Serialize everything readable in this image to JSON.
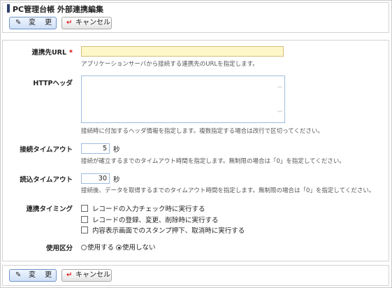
{
  "page": {
    "title": "PC管理台帳 外部連携編集"
  },
  "toolbar": {
    "change_label": "変 更",
    "change_icon": "pencil-icon",
    "cancel_label": "キャンセル",
    "cancel_icon": "return-arrow-icon"
  },
  "form": {
    "url": {
      "label": "連携先URL",
      "required_mark": "*",
      "value": "",
      "help": "アプリケーションサーバから接続する連携先のURLを指定します。"
    },
    "http_header": {
      "label": "HTTPヘッダ",
      "value": "",
      "help": "接続時に付加するヘッダ情報を指定します。複数指定する場合は改行で区切ってください。"
    },
    "connect_timeout": {
      "label": "接続タイムアウト",
      "value": "5",
      "unit": "秒",
      "help": "接続が確立するまでのタイムアウト時間を指定します。無制限の場合は「0」を指定してください。"
    },
    "read_timeout": {
      "label": "読込タイムアウト",
      "value": "30",
      "unit": "秒",
      "help": "接続後、データを取得するまでのタイムアウト時間を指定します。無制限の場合は「0」を指定してください。"
    },
    "timing": {
      "label": "連携タイミング",
      "options": [
        {
          "label": "レコードの入力チェック時に実行する",
          "checked": false
        },
        {
          "label": "レコードの登録、変更、削除時に実行する",
          "checked": false
        },
        {
          "label": "内容表示画面でのスタンプ押下、取消時に実行する",
          "checked": false
        }
      ]
    },
    "usage": {
      "label": "使用区分",
      "options": [
        {
          "label": "使用する",
          "selected": false
        },
        {
          "label": "使用しない",
          "selected": true
        }
      ]
    }
  }
}
